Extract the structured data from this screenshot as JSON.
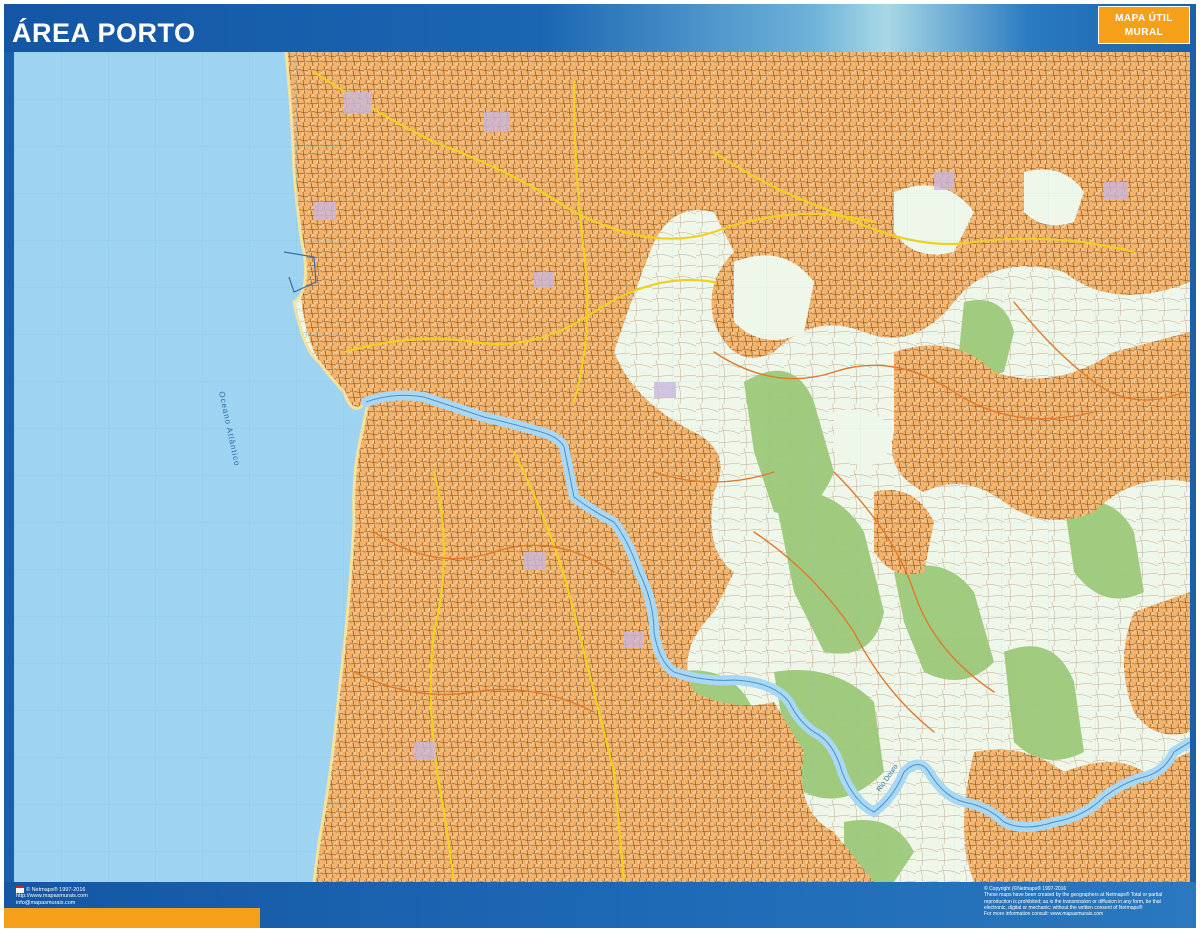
{
  "map": {
    "title": "ÁREA PORTO",
    "badge_line1": "MAPA ÚTIL",
    "badge_line2": "MURAL",
    "ocean_label": "Oceano Atlântico",
    "river_label": "Rio Douro",
    "colors": {
      "sea": "#9fd3f2",
      "urban": "#f4b46c",
      "land": "#eef7ea",
      "forest": "#9cc97a",
      "river": "#a8d8f4",
      "road_major": "#f0d020",
      "road_minor": "#e08a3a",
      "frame": "#1a5fa8",
      "accent": "#f6a01a"
    }
  },
  "footer": {
    "left_line1": "© Netmaps® 1997-2016",
    "left_line2": "http://www.mapasmurais.com",
    "left_line3": "info@mapasmurais.com",
    "right_line1": "© Copyright (©Netmaps® 1997-2016",
    "right_line2": "These maps have been created by the geographers at Netmaps® Total or partial",
    "right_line3": "reproduction is prohibited; as is the transmission or diffusion in any form, be that",
    "right_line4": "electronic, digital or mechanic; without the written consent of Netmaps®",
    "right_line5": "For more information consult: www.mapasmurais.com"
  }
}
